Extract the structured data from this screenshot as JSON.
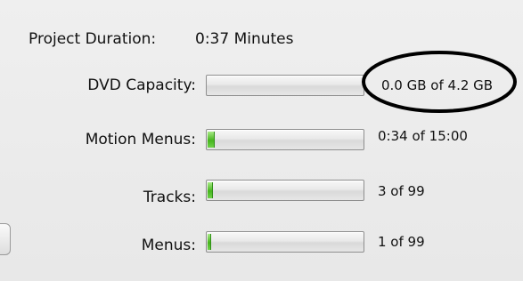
{
  "project_duration": {
    "label": "Project Duration:",
    "value": "0:37 Minutes"
  },
  "rows": [
    {
      "label": "DVD Capacity:",
      "value": "0.0 GB of 4.2 GB",
      "fraction": 0.0
    },
    {
      "label": "Motion Menus:",
      "value": "0:34 of 15:00",
      "fraction": 0.038
    },
    {
      "label": "Tracks:",
      "value": "3 of 99",
      "fraction": 0.03
    },
    {
      "label": "Menus:",
      "value": "1 of 99",
      "fraction": 0.01
    }
  ],
  "colors": {
    "progress_fill": "#46b51d",
    "annotation_circle": "#000000"
  }
}
